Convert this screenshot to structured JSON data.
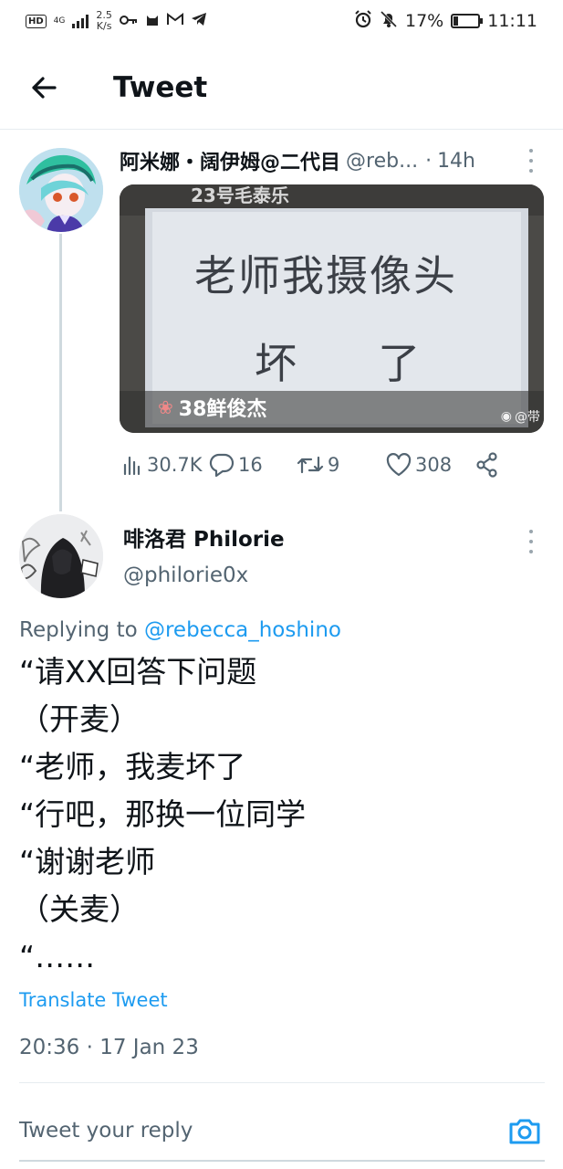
{
  "status_bar": {
    "network_badge": "HD",
    "network_type": "4G",
    "speed_value": "2.5",
    "speed_unit": "K/s",
    "battery": "17%",
    "time": "11:11",
    "left_icons": [
      "key-icon",
      "cat-icon",
      "gmail-icon",
      "telegram-icon"
    ],
    "right_icons": [
      "alarm-icon",
      "mute-icon",
      "battery-icon"
    ]
  },
  "header": {
    "title": "Tweet",
    "back_icon": "arrow-left-icon"
  },
  "quoted_tweet": {
    "author_name": "阿米娜・阔伊姆@二代目",
    "author_handle": "@reb...",
    "separator": "·",
    "time": "14h",
    "media": {
      "card_line1": "老师我摄像头",
      "card_line2": "坏  了",
      "top_text": "23号毛泰乐",
      "bottom_label": "38鲜俊杰",
      "watermark": "@带"
    },
    "stats": {
      "views": "30.7K",
      "replies": "16",
      "retweets": "9",
      "likes": "308"
    }
  },
  "main_tweet": {
    "author_name": "啡洛君 Philorie",
    "author_handle": "@philorie0x",
    "replying_prefix": "Replying to",
    "replying_to": "@rebecca_hoshino",
    "text_lines": [
      "“请XX回答下问题",
      "（开麦）",
      "“老师，我麦坏了",
      "“行吧，那换一位同学",
      "“谢谢老师",
      "（关麦）",
      "“……"
    ],
    "translate_label": "Translate Tweet",
    "timestamp": "20:36 · 17 Jan 23"
  },
  "reply_box": {
    "placeholder": "Tweet your reply",
    "camera_icon": "camera-icon"
  },
  "colors": {
    "accent": "#1d9bf0",
    "text_primary": "#0f1419",
    "text_secondary": "#536471",
    "divider": "#e6ecf0"
  }
}
